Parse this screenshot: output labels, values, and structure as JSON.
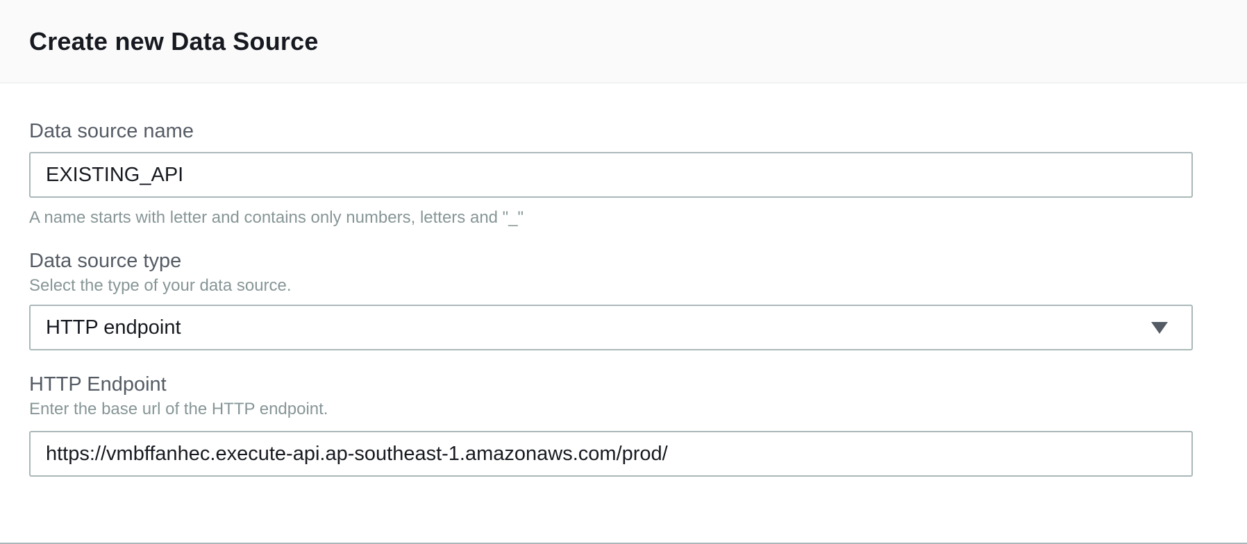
{
  "header": {
    "title": "Create new Data Source"
  },
  "form": {
    "name_field": {
      "label": "Data source name",
      "value": "EXISTING_API",
      "hint": "A name starts with letter and contains only numbers, letters and \"_\""
    },
    "type_field": {
      "label": "Data source type",
      "description": "Select the type of your data source.",
      "selected": "HTTP endpoint",
      "icon": "caret-down-icon"
    },
    "endpoint_field": {
      "label": "HTTP Endpoint",
      "description": "Enter the base url of the HTTP endpoint.",
      "value": "https://vmbffanhec.execute-api.ap-southeast-1.amazonaws.com/prod/"
    }
  },
  "colors": {
    "title": "#16191f",
    "label": "#545b64",
    "hint": "#879596",
    "border": "#aab7b8",
    "header_bg": "#fafafa"
  }
}
